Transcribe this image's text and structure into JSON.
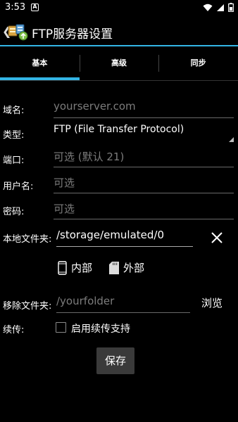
{
  "status_bar": {
    "time": "3:53",
    "notification_letter": "A"
  },
  "action_bar": {
    "back_glyph": "❮",
    "title": "FTP服务器设置"
  },
  "tabs": [
    {
      "label": "基本",
      "active": true
    },
    {
      "label": "高级",
      "active": false
    },
    {
      "label": "同步",
      "active": false
    }
  ],
  "form": {
    "domain": {
      "label": "域名:",
      "placeholder": "yourserver.com"
    },
    "type": {
      "label": "类型:",
      "value": "FTP (File Transfer Protocol)"
    },
    "port": {
      "label": "端口:",
      "placeholder": "可选 (默认 21)"
    },
    "username": {
      "label": "用户名:",
      "placeholder": "可选"
    },
    "password": {
      "label": "密码:",
      "placeholder": "可选"
    },
    "local_folder": {
      "label": "本地文件夹:",
      "value": "/storage/emulated/0"
    },
    "storage": {
      "internal": "内部",
      "external": "外部"
    },
    "remote_folder": {
      "label": "移除文件夹:",
      "placeholder": "/yourfolder",
      "browse": "浏览"
    },
    "resume": {
      "label": "续传:",
      "checkbox_label": "启用续传支持",
      "checked": false
    }
  },
  "save_label": "保存",
  "colors": {
    "accent": "#33b5e5",
    "background": "#000000",
    "placeholder": "#7c7c7c"
  }
}
